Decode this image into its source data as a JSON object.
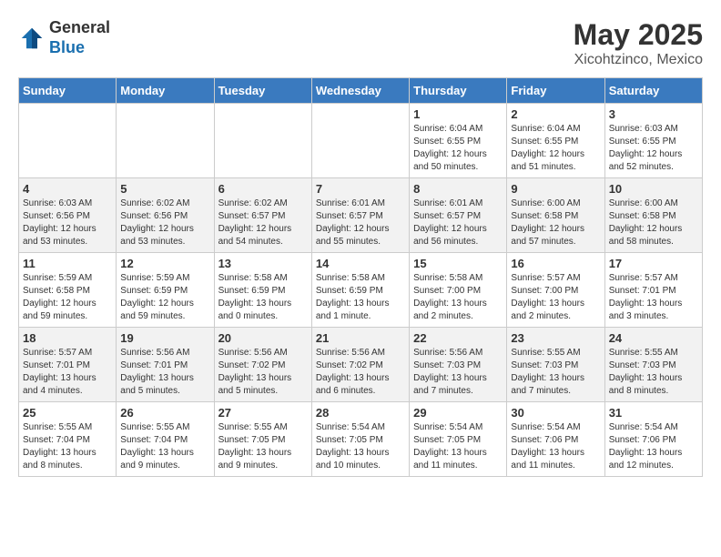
{
  "header": {
    "logo_general": "General",
    "logo_blue": "Blue",
    "month_year": "May 2025",
    "location": "Xicohtzinco, Mexico"
  },
  "days_of_week": [
    "Sunday",
    "Monday",
    "Tuesday",
    "Wednesday",
    "Thursday",
    "Friday",
    "Saturday"
  ],
  "weeks": [
    [
      {
        "day": "",
        "info": ""
      },
      {
        "day": "",
        "info": ""
      },
      {
        "day": "",
        "info": ""
      },
      {
        "day": "",
        "info": ""
      },
      {
        "day": "1",
        "info": "Sunrise: 6:04 AM\nSunset: 6:55 PM\nDaylight: 12 hours and 50 minutes."
      },
      {
        "day": "2",
        "info": "Sunrise: 6:04 AM\nSunset: 6:55 PM\nDaylight: 12 hours and 51 minutes."
      },
      {
        "day": "3",
        "info": "Sunrise: 6:03 AM\nSunset: 6:55 PM\nDaylight: 12 hours and 52 minutes."
      }
    ],
    [
      {
        "day": "4",
        "info": "Sunrise: 6:03 AM\nSunset: 6:56 PM\nDaylight: 12 hours and 53 minutes."
      },
      {
        "day": "5",
        "info": "Sunrise: 6:02 AM\nSunset: 6:56 PM\nDaylight: 12 hours and 53 minutes."
      },
      {
        "day": "6",
        "info": "Sunrise: 6:02 AM\nSunset: 6:57 PM\nDaylight: 12 hours and 54 minutes."
      },
      {
        "day": "7",
        "info": "Sunrise: 6:01 AM\nSunset: 6:57 PM\nDaylight: 12 hours and 55 minutes."
      },
      {
        "day": "8",
        "info": "Sunrise: 6:01 AM\nSunset: 6:57 PM\nDaylight: 12 hours and 56 minutes."
      },
      {
        "day": "9",
        "info": "Sunrise: 6:00 AM\nSunset: 6:58 PM\nDaylight: 12 hours and 57 minutes."
      },
      {
        "day": "10",
        "info": "Sunrise: 6:00 AM\nSunset: 6:58 PM\nDaylight: 12 hours and 58 minutes."
      }
    ],
    [
      {
        "day": "11",
        "info": "Sunrise: 5:59 AM\nSunset: 6:58 PM\nDaylight: 12 hours and 59 minutes."
      },
      {
        "day": "12",
        "info": "Sunrise: 5:59 AM\nSunset: 6:59 PM\nDaylight: 12 hours and 59 minutes."
      },
      {
        "day": "13",
        "info": "Sunrise: 5:58 AM\nSunset: 6:59 PM\nDaylight: 13 hours and 0 minutes."
      },
      {
        "day": "14",
        "info": "Sunrise: 5:58 AM\nSunset: 6:59 PM\nDaylight: 13 hours and 1 minute."
      },
      {
        "day": "15",
        "info": "Sunrise: 5:58 AM\nSunset: 7:00 PM\nDaylight: 13 hours and 2 minutes."
      },
      {
        "day": "16",
        "info": "Sunrise: 5:57 AM\nSunset: 7:00 PM\nDaylight: 13 hours and 2 minutes."
      },
      {
        "day": "17",
        "info": "Sunrise: 5:57 AM\nSunset: 7:01 PM\nDaylight: 13 hours and 3 minutes."
      }
    ],
    [
      {
        "day": "18",
        "info": "Sunrise: 5:57 AM\nSunset: 7:01 PM\nDaylight: 13 hours and 4 minutes."
      },
      {
        "day": "19",
        "info": "Sunrise: 5:56 AM\nSunset: 7:01 PM\nDaylight: 13 hours and 5 minutes."
      },
      {
        "day": "20",
        "info": "Sunrise: 5:56 AM\nSunset: 7:02 PM\nDaylight: 13 hours and 5 minutes."
      },
      {
        "day": "21",
        "info": "Sunrise: 5:56 AM\nSunset: 7:02 PM\nDaylight: 13 hours and 6 minutes."
      },
      {
        "day": "22",
        "info": "Sunrise: 5:56 AM\nSunset: 7:03 PM\nDaylight: 13 hours and 7 minutes."
      },
      {
        "day": "23",
        "info": "Sunrise: 5:55 AM\nSunset: 7:03 PM\nDaylight: 13 hours and 7 minutes."
      },
      {
        "day": "24",
        "info": "Sunrise: 5:55 AM\nSunset: 7:03 PM\nDaylight: 13 hours and 8 minutes."
      }
    ],
    [
      {
        "day": "25",
        "info": "Sunrise: 5:55 AM\nSunset: 7:04 PM\nDaylight: 13 hours and 8 minutes."
      },
      {
        "day": "26",
        "info": "Sunrise: 5:55 AM\nSunset: 7:04 PM\nDaylight: 13 hours and 9 minutes."
      },
      {
        "day": "27",
        "info": "Sunrise: 5:55 AM\nSunset: 7:05 PM\nDaylight: 13 hours and 9 minutes."
      },
      {
        "day": "28",
        "info": "Sunrise: 5:54 AM\nSunset: 7:05 PM\nDaylight: 13 hours and 10 minutes."
      },
      {
        "day": "29",
        "info": "Sunrise: 5:54 AM\nSunset: 7:05 PM\nDaylight: 13 hours and 11 minutes."
      },
      {
        "day": "30",
        "info": "Sunrise: 5:54 AM\nSunset: 7:06 PM\nDaylight: 13 hours and 11 minutes."
      },
      {
        "day": "31",
        "info": "Sunrise: 5:54 AM\nSunset: 7:06 PM\nDaylight: 13 hours and 12 minutes."
      }
    ]
  ]
}
